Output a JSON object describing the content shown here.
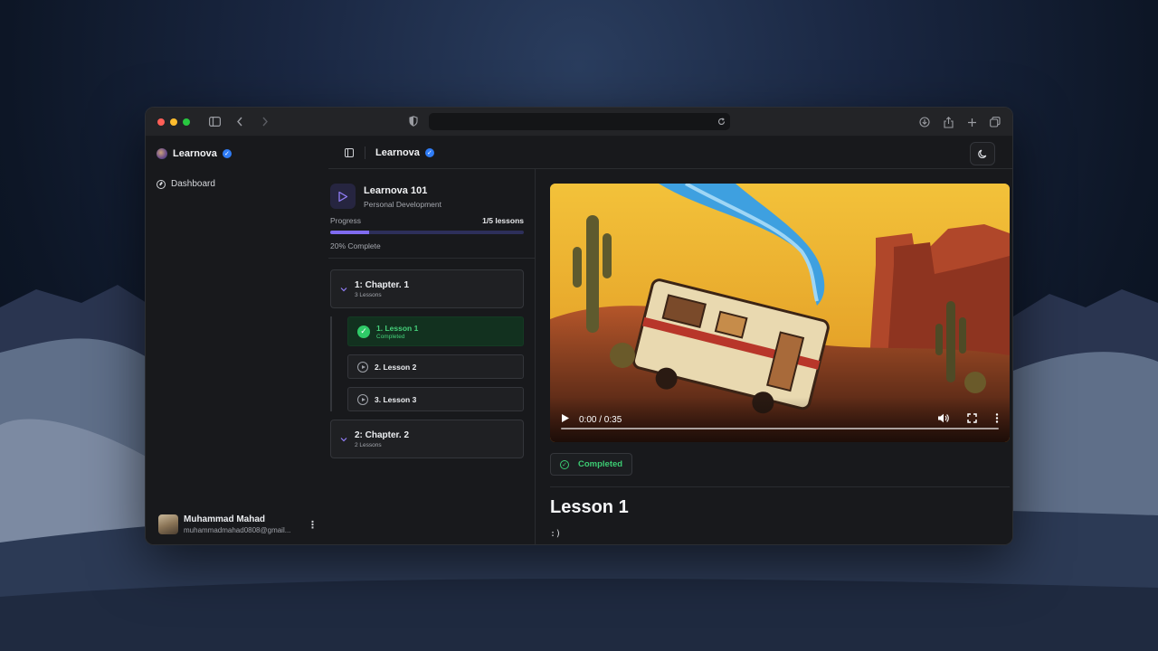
{
  "app": {
    "name": "Learnova"
  },
  "sidebar": {
    "brand": "Learnova",
    "nav": [
      {
        "label": "Dashboard",
        "icon": "compass-icon"
      }
    ],
    "user": {
      "name": "Muhammad Mahad",
      "email": "muhammadmahad0808@gmail..."
    }
  },
  "topbar": {
    "title": "Learnova"
  },
  "course": {
    "title": "Learnova 101",
    "category": "Personal Development",
    "progress_label": "Progress",
    "progress_count": "1/5 lessons",
    "progress_fraction": 0.2,
    "progress_pct": "20% Complete",
    "chapters": [
      {
        "title": "1: Chapter. 1",
        "sub": "3 Lessons",
        "lessons": [
          {
            "title": "1. Lesson 1",
            "status": "Completed"
          },
          {
            "title": "2. Lesson 2"
          },
          {
            "title": "3. Lesson 3"
          }
        ]
      },
      {
        "title": "2: Chapter. 2",
        "sub": "2 Lessons"
      }
    ]
  },
  "video": {
    "time": "0:00 / 0:35"
  },
  "lesson": {
    "status_button": "Completed",
    "title": "Lesson 1",
    "description": ":)"
  },
  "colors": {
    "accent": "#7f6bf0",
    "success": "#3ccc73",
    "background": "#18191c"
  }
}
